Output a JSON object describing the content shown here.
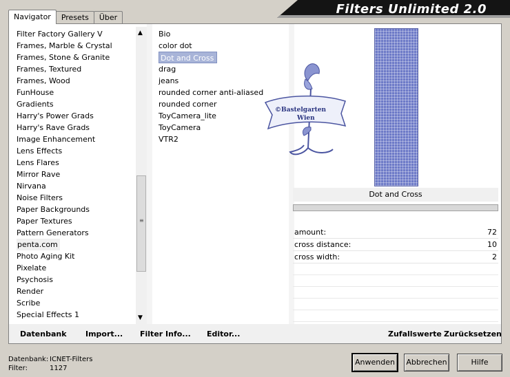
{
  "header": {
    "title": "Filters Unlimited 2.0"
  },
  "tabs": [
    {
      "label": "Navigator",
      "active": true
    },
    {
      "label": "Presets",
      "active": false
    },
    {
      "label": "Über",
      "active": false
    }
  ],
  "categories": [
    "Filter Factory Gallery V",
    "Frames, Marble & Crystal",
    "Frames, Stone & Granite",
    "Frames, Textured",
    "Frames, Wood",
    "FunHouse",
    "Gradients",
    "Harry's Power Grads",
    "Harry's Rave Grads",
    "Image Enhancement",
    "Lens Effects",
    "Lens Flares",
    "Mirror Rave",
    "Nirvana",
    "Noise Filters",
    "Paper Backgrounds",
    "Paper Textures",
    "Pattern Generators",
    "penta.com",
    "Photo Aging Kit",
    "Pixelate",
    "Psychosis",
    "Render",
    "Scribe",
    "Special Effects 1"
  ],
  "selected_category": "penta.com",
  "filters": [
    "Bio",
    "color dot",
    "Dot and Cross",
    "drag",
    "jeans",
    "rounded corner anti-aliased",
    "rounded corner",
    "ToyCamera_lite",
    "ToyCamera",
    "VTR2"
  ],
  "selected_filter": "Dot and Cross",
  "preview": {
    "watermark_line1": "©Bastelgarten",
    "watermark_line2": "Wien"
  },
  "filter_name": "Dot and Cross",
  "params": [
    {
      "label": "amount:",
      "value": "72"
    },
    {
      "label": "cross distance:",
      "value": "10"
    },
    {
      "label": "cross width:",
      "value": "2"
    }
  ],
  "bottom_links": {
    "datenbank": "Datenbank",
    "import": "Import...",
    "filter_info": "Filter Info...",
    "editor": "Editor...",
    "zufallswerte": "Zufallswerte",
    "zuruecksetzen": "Zurücksetzen"
  },
  "status": {
    "db_label": "Datenbank:",
    "db_value": "ICNET-Filters",
    "filter_label": "Filter:",
    "filter_value": "1127"
  },
  "buttons": {
    "apply": "Anwenden",
    "cancel": "Abbrechen",
    "help": "Hilfe"
  },
  "colors": {
    "selection": "#a8b4d8",
    "preview": "#6e7bc8",
    "title_bg": "#141414"
  }
}
